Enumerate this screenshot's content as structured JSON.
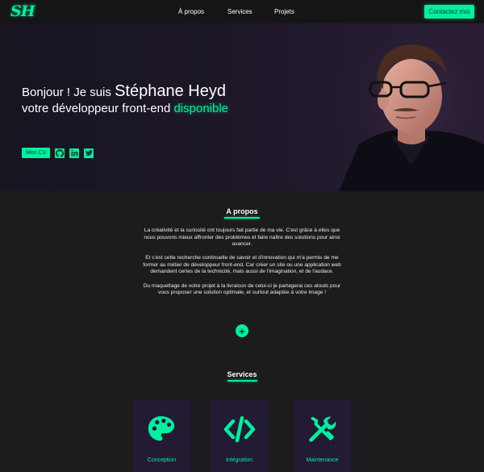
{
  "nav": {
    "logo": "SH",
    "links": [
      "À propos",
      "Services",
      "Projets"
    ],
    "contact_label": "Contactez moi"
  },
  "hero": {
    "greeting": "Bonjour ! Je suis ",
    "name": "Stéphane Heyd",
    "role": "votre développeur front-end ",
    "status": "disponible",
    "cv_label": "Mon CV",
    "social_icons": [
      "github-icon",
      "linkedin-icon",
      "twitter-icon"
    ]
  },
  "about": {
    "title": "A propos",
    "paragraphs": [
      "La créativité et la curiosité ont toujours fait partie de ma vie. C'est grâce à elles que nous pouvons mieux affronter des problèmes et faire naître des solutions pour ainsi avancer.",
      "Et c'est cette recherche continuelle de savoir et d'innovation qui m'a permis de me former au métier de développeur front-end. Car créer un site ou une application web demandent certes de la technicité, mais aussi de l'imagination, et de l'audace.",
      "Du maquettage de votre projet à la livraison de celui-ci je partagerai ces atouts pour vous proposer une solution optimale, et surtout adaptée à votre image !"
    ],
    "more_label": "+"
  },
  "services": {
    "title": "Services",
    "items": [
      {
        "label": "Conception",
        "icon": "palette-icon"
      },
      {
        "label": "Intégration",
        "icon": "code-icon"
      },
      {
        "label": "Maintenance",
        "icon": "tools-icon"
      }
    ]
  },
  "colors": {
    "accent": "#00f0a0",
    "background": "#1c1c1e",
    "card": "#231a33"
  }
}
